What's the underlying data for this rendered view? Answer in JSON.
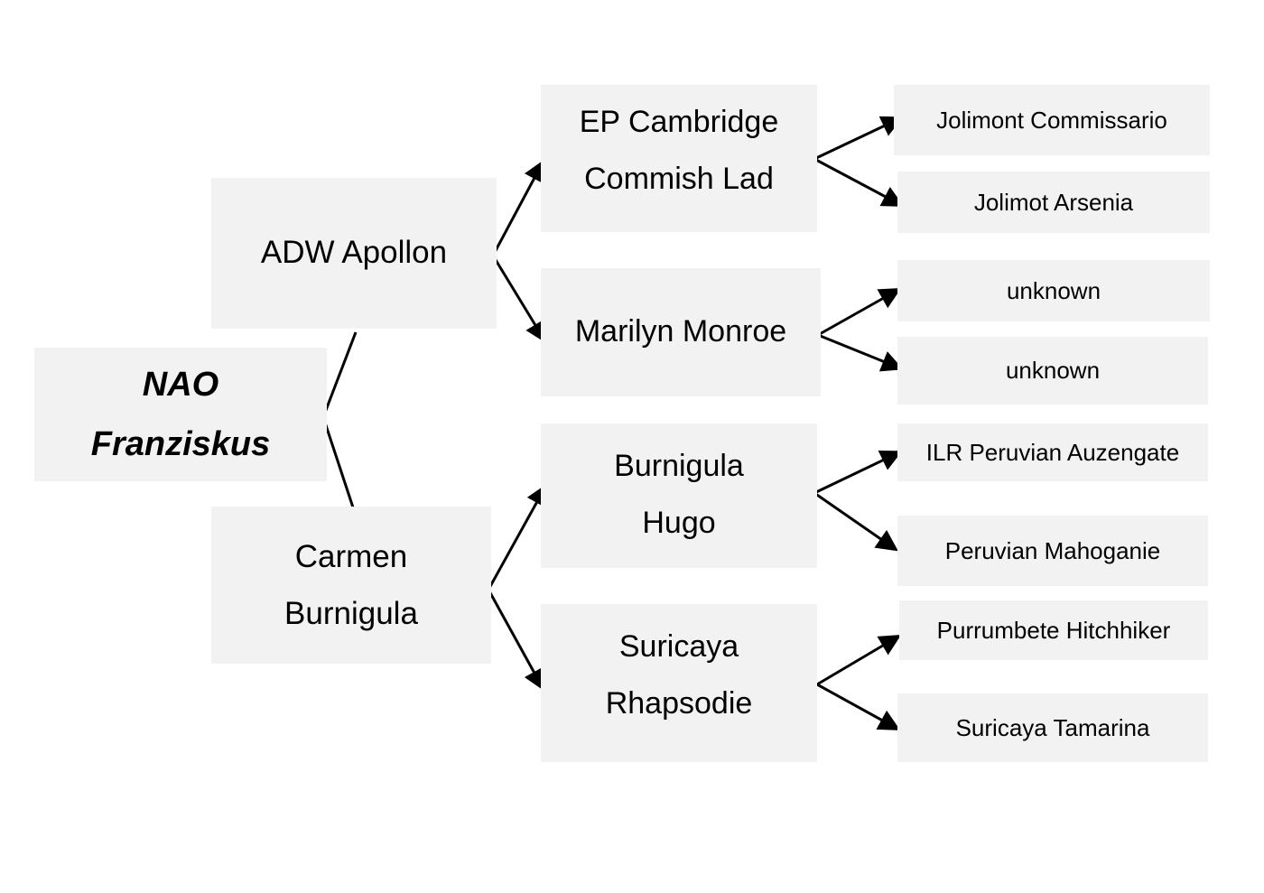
{
  "tree": {
    "root": {
      "lines": [
        "NAO",
        "Franziskus"
      ]
    },
    "parents": [
      {
        "id": "sire",
        "lines": [
          "ADW Apollon"
        ]
      },
      {
        "id": "dam",
        "lines": [
          "Carmen",
          "Burnigula"
        ]
      }
    ],
    "grandparents": [
      {
        "id": "sire-sire",
        "lines": [
          "EP Cambridge",
          "Commish Lad"
        ]
      },
      {
        "id": "sire-dam",
        "lines": [
          "Marilyn Monroe"
        ]
      },
      {
        "id": "dam-sire",
        "lines": [
          "Burnigula",
          "Hugo"
        ]
      },
      {
        "id": "dam-dam",
        "lines": [
          "Suricaya",
          "Rhapsodie"
        ]
      }
    ],
    "great_grandparents": [
      {
        "id": "gg1",
        "label": "Jolimont Commissario"
      },
      {
        "id": "gg2",
        "label": "Jolimot Arsenia"
      },
      {
        "id": "gg3",
        "label": "unknown"
      },
      {
        "id": "gg4",
        "label": "unknown"
      },
      {
        "id": "gg5",
        "label": "ILR Peruvian Auzengate"
      },
      {
        "id": "gg6",
        "label": "Peruvian Mahoganie"
      },
      {
        "id": "gg7",
        "label": "Purrumbete Hitchhiker"
      },
      {
        "id": "gg8",
        "label": "Suricaya Tamarina"
      }
    ]
  }
}
